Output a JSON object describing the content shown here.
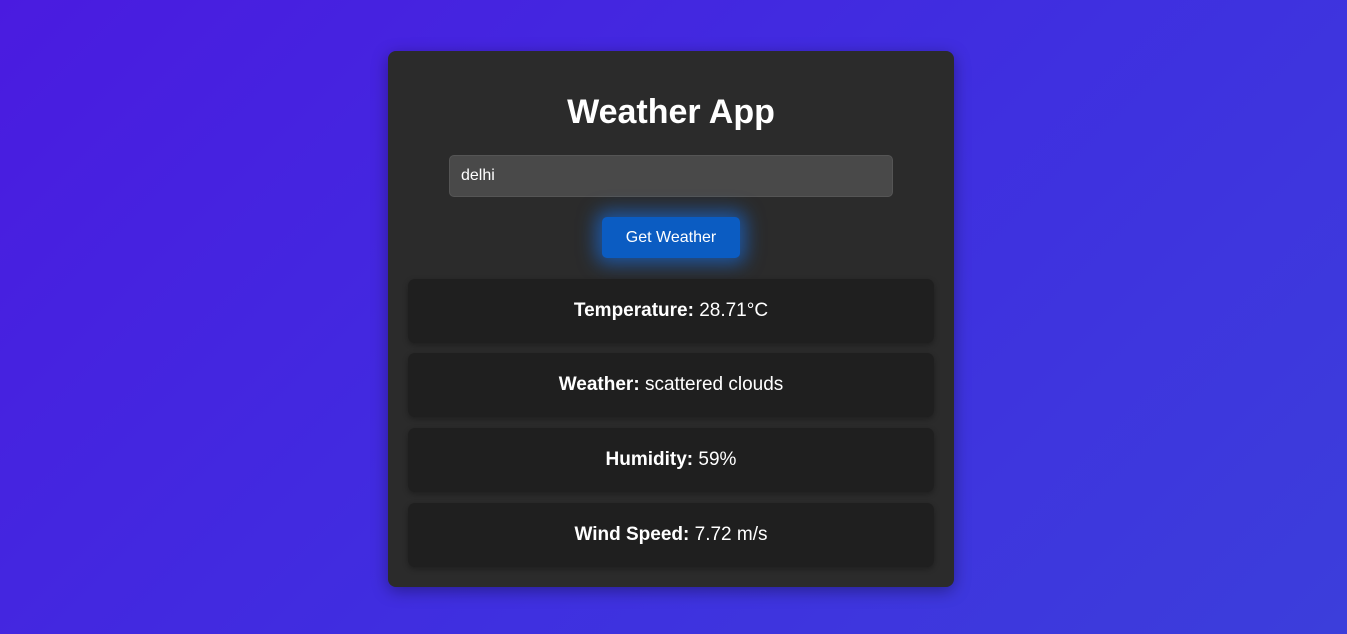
{
  "app": {
    "title": "Weather App"
  },
  "search": {
    "value": "delhi",
    "button_label": "Get Weather"
  },
  "results": {
    "temperature": {
      "label": "Temperature:",
      "value": "28.71°C"
    },
    "weather": {
      "label": "Weather:",
      "value": "scattered clouds"
    },
    "humidity": {
      "label": "Humidity:",
      "value": "59%"
    },
    "wind_speed": {
      "label": "Wind Speed:",
      "value": "7.72 m/s"
    }
  },
  "colors": {
    "background_start": "#4a1be0",
    "background_end": "#3c3edb",
    "card": "#2b2b2b",
    "info_box": "#1f1f1f",
    "button": "#0b5cc2",
    "input": "#494949"
  }
}
